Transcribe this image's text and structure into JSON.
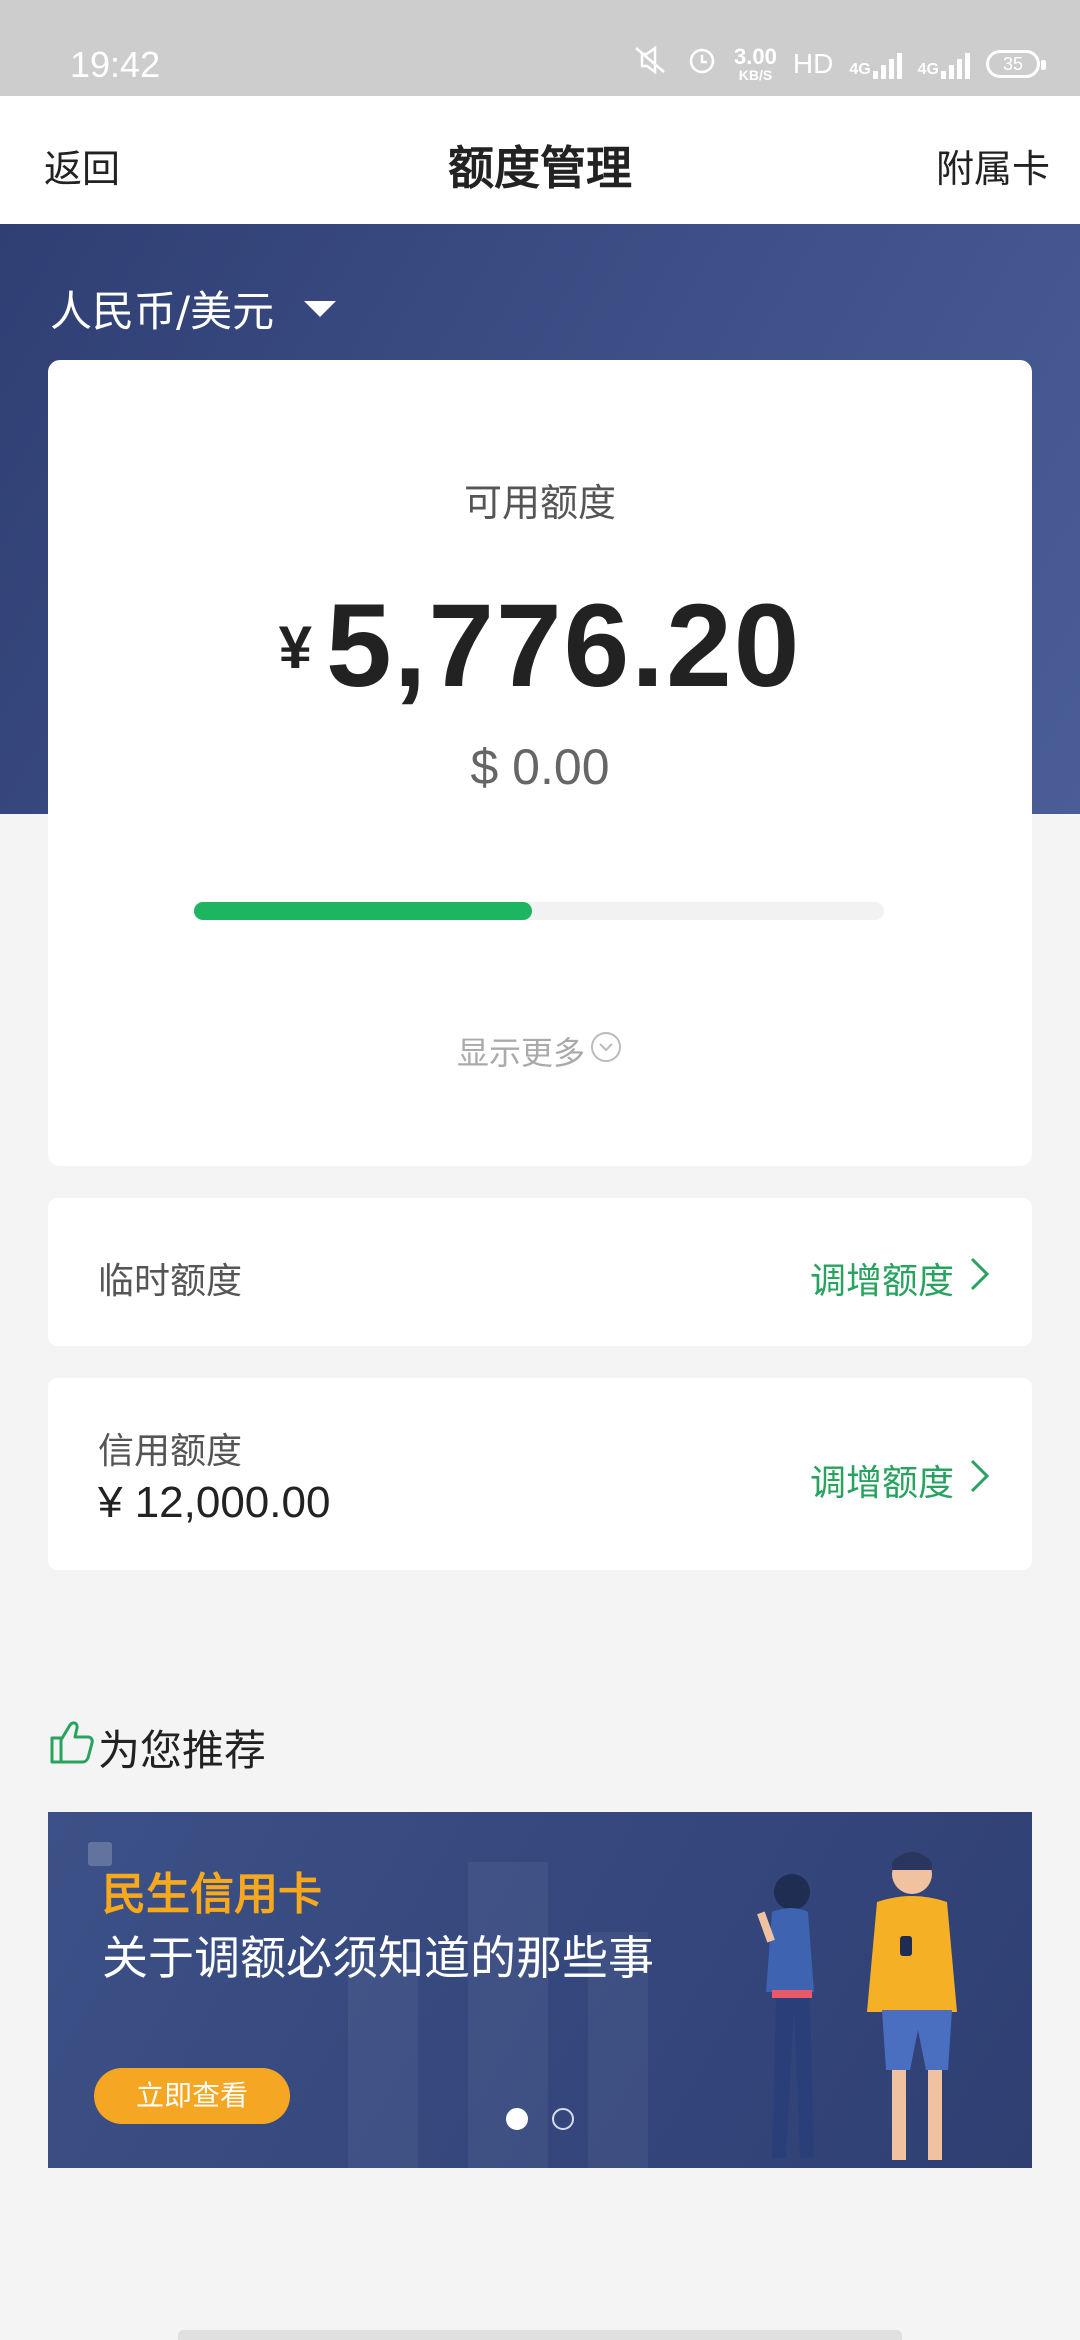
{
  "status_bar": {
    "time": "19:42",
    "net_speed_value": "3.00",
    "net_speed_unit": "KB/S",
    "hd": "HD",
    "network_1": "4G",
    "network_2": "4G",
    "battery": "35"
  },
  "nav": {
    "back_label": "返回",
    "title": "额度管理",
    "right_label": "附属卡"
  },
  "currency_selector": {
    "label": "人民币/美元"
  },
  "available": {
    "label": "可用额度",
    "symbol": "¥",
    "amount": "5,776.20",
    "usd_amount": "$ 0.00",
    "progress_fraction": 0.49,
    "show_more_label": "显示更多"
  },
  "temporary_limit": {
    "label": "临时额度",
    "action_label": "调增额度"
  },
  "credit_limit": {
    "label": "信用额度",
    "value": "¥ 12,000.00",
    "action_label": "调增额度"
  },
  "recommend": {
    "title": "为您推荐",
    "banner": {
      "brand": "民生信用卡",
      "headline": "关于调额必须知道的那些事",
      "button_label": "立即查看",
      "active_page": 1,
      "page_count": 2
    }
  },
  "colors": {
    "accent_green": "#27a35f",
    "progress_green": "#1db560",
    "banner_blue": "#34467c",
    "promo_orange": "#f5a623"
  }
}
